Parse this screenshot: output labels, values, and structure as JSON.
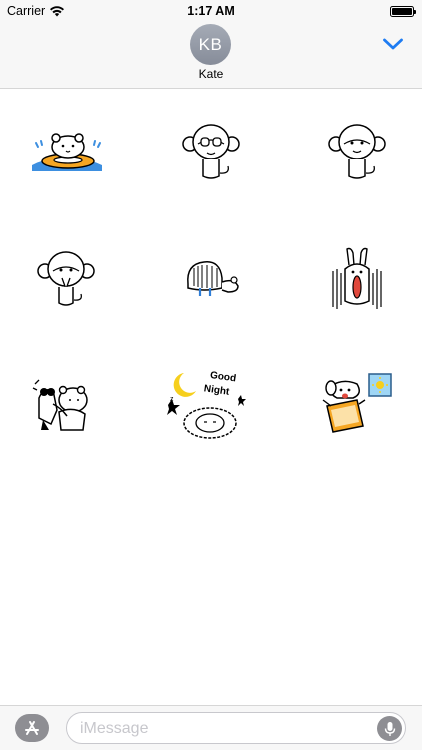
{
  "status_bar": {
    "carrier": "Carrier",
    "time": "1:17 AM",
    "icons": [
      "wifi-icon",
      "battery-icon"
    ]
  },
  "header": {
    "avatar_initials": "KB",
    "contact_name": "Kate",
    "collapse_icon": "chevron-down-icon",
    "accent_color": "#1e7cf2"
  },
  "stickers": [
    {
      "name": "bear-swim-ring-sticker"
    },
    {
      "name": "monkey-covering-eyes-sticker"
    },
    {
      "name": "monkey-covering-ears-sticker"
    },
    {
      "name": "monkey-covering-mouth-sticker"
    },
    {
      "name": "crying-girl-sticker"
    },
    {
      "name": "scared-rabbit-sticker"
    },
    {
      "name": "bears-hugging-sticker"
    },
    {
      "name": "good-night-sheep-sticker",
      "text_line1": "Good",
      "text_line2": "Night"
    },
    {
      "name": "dog-with-toast-sticker"
    }
  ],
  "bottom_bar": {
    "appstore_icon": "app-store-icon",
    "message_placeholder": "iMessage",
    "mic_icon": "microphone-icon"
  }
}
